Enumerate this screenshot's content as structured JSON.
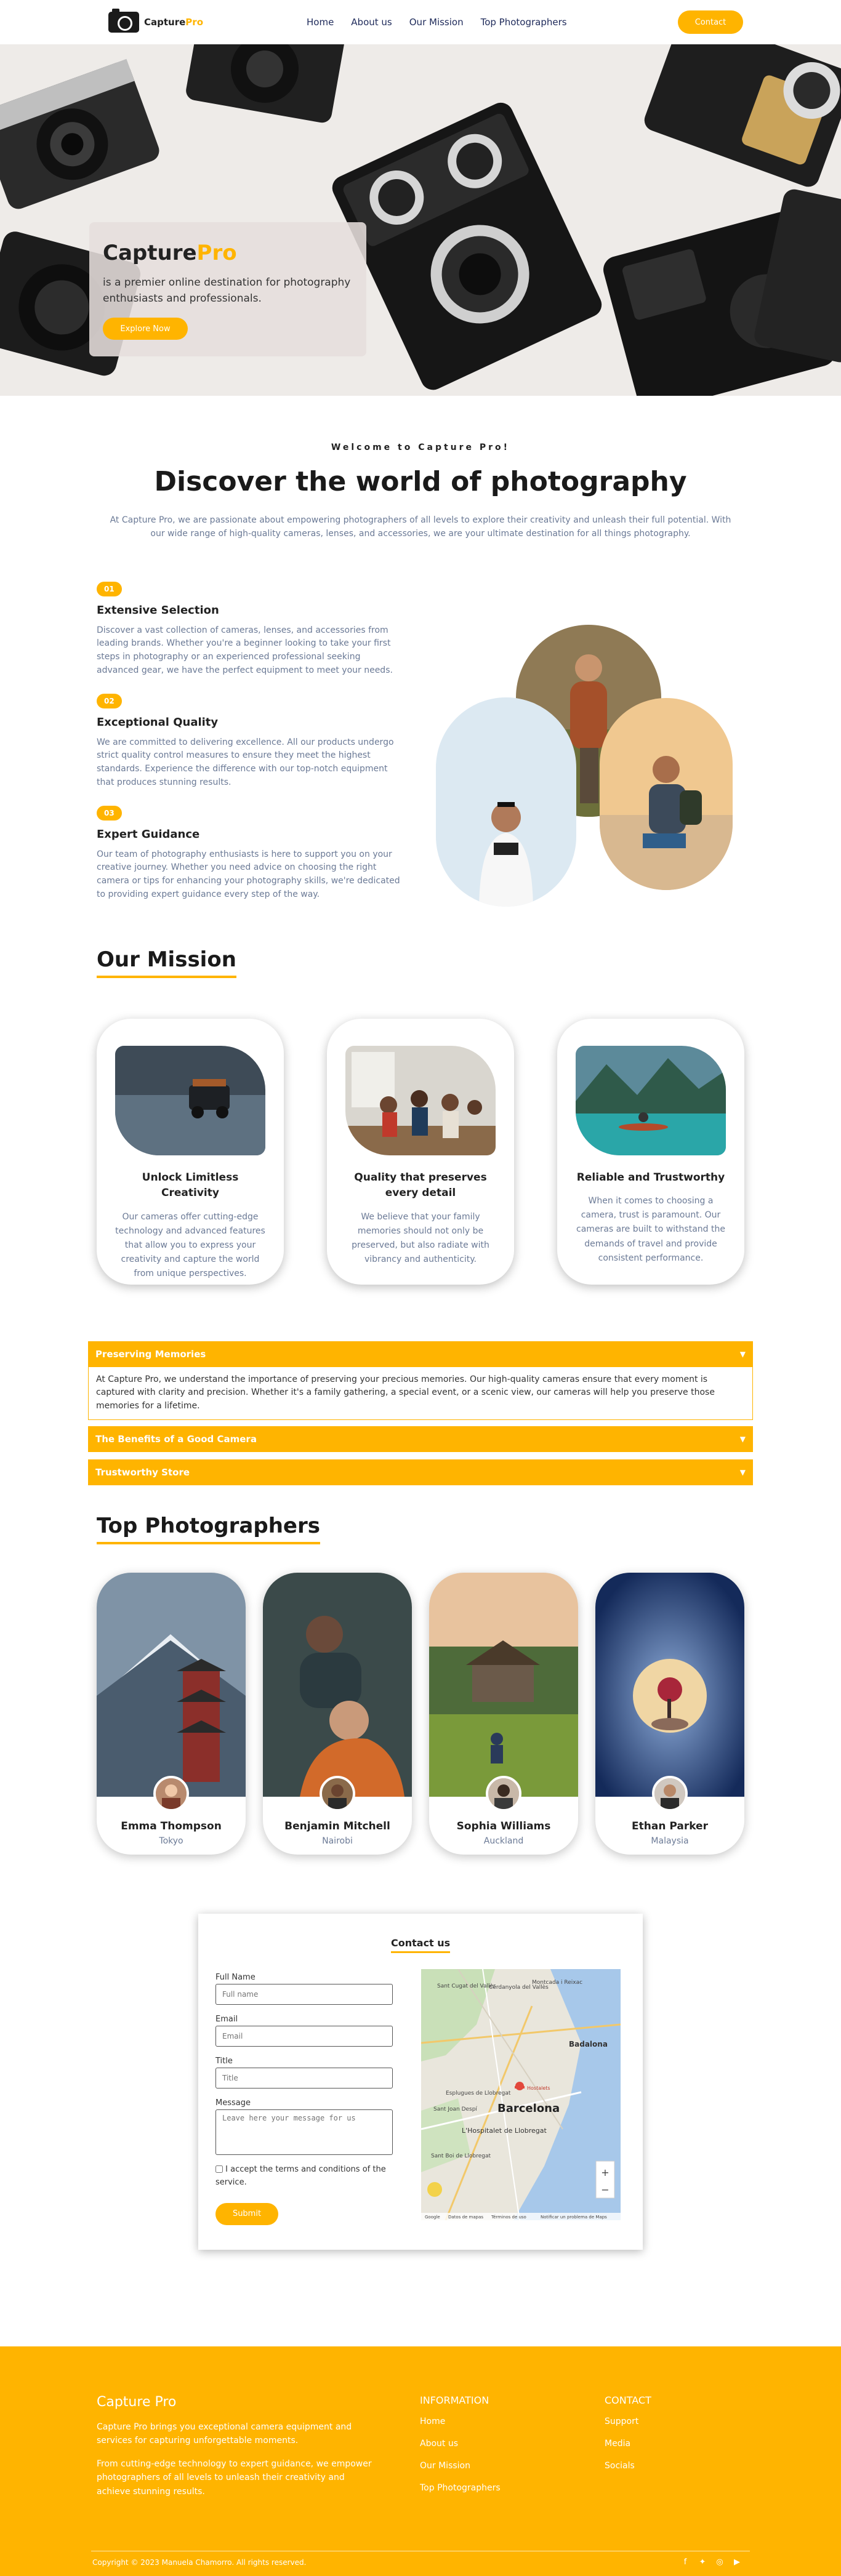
{
  "nav": {
    "brand_main": "Capture",
    "brand_accent": "Pro",
    "links": [
      "Home",
      "About us",
      "Our Mission",
      "Top Photographers"
    ],
    "contact_label": "Contact"
  },
  "hero": {
    "title_main": "Capture",
    "title_accent": "Pro",
    "subtitle": "is a premier online destination for photography enthusiasts and professionals.",
    "button": "Explore Now"
  },
  "welcome": {
    "eyebrow": "Welcome to Capture Pro!",
    "heading": "Discover the world of photography",
    "lead": "At Capture Pro, we are passionate about empowering photographers of all levels to explore their creativity and unleash their full potential. With our wide range of high-quality cameras, lenses, and accessories, we are your ultimate destination for all things photography."
  },
  "features": [
    {
      "badge": "01",
      "title": "Extensive Selection",
      "text": "Discover a vast collection of cameras, lenses, and accessories from leading brands. Whether you're a beginner looking to take your first steps in photography or an experienced professional seeking advanced gear, we have the perfect equipment to meet your needs."
    },
    {
      "badge": "02",
      "title": "Exceptional Quality",
      "text": "We are committed to delivering excellence. All our products undergo strict quality control measures to ensure they meet the highest standards. Experience the difference with our top-notch equipment that produces stunning results."
    },
    {
      "badge": "03",
      "title": "Expert Guidance",
      "text": "Our team of photography enthusiasts is here to support you on your creative journey. Whether you need advice on choosing the right camera or tips for enhancing your photography skills, we're dedicated to providing expert guidance every step of the way."
    }
  ],
  "mission": {
    "heading": "Our Mission",
    "cards": [
      {
        "title": "Unlock Limitless Creativity",
        "text": "Our cameras offer cutting-edge technology and advanced features that allow you to express your creativity and capture the world from unique perspectives."
      },
      {
        "title": "Quality that preserves every detail",
        "text": "We believe that your family memories should not only be preserved, but also radiate with vibrancy and authenticity."
      },
      {
        "title": "Reliable and Trustworthy",
        "text": "When it comes to choosing a camera, trust is paramount. Our cameras are built to withstand the demands of travel and provide consistent performance."
      }
    ]
  },
  "accordion": [
    {
      "title": "Preserving Memories",
      "body": "At Capture Pro, we understand the importance of preserving your precious memories. Our high-quality cameras ensure that every moment is captured with clarity and precision. Whether it's a family gathering, a special event, or a scenic view, our cameras will help you preserve those memories for a lifetime."
    },
    {
      "title": "The Benefits of a Good Camera"
    },
    {
      "title": "Trustworthy Store"
    }
  ],
  "photographers": {
    "heading": "Top Photographers",
    "people": [
      {
        "name": "Emma Thompson",
        "city": "Tokyo"
      },
      {
        "name": "Benjamin Mitchell",
        "city": "Nairobi"
      },
      {
        "name": "Sophia Williams",
        "city": "Auckland"
      },
      {
        "name": "Ethan Parker",
        "city": "Malaysia"
      }
    ]
  },
  "contact": {
    "title": "Contact us",
    "fields": [
      {
        "label": "Full Name",
        "placeholder": "Full name"
      },
      {
        "label": "Email",
        "placeholder": "Email"
      },
      {
        "label": "Title",
        "placeholder": "Title"
      },
      {
        "label": "Message",
        "placeholder": "Leave here your message for us"
      }
    ],
    "checkbox": "I accept the terms and conditions of the service.",
    "submit": "Submit",
    "map_labels": [
      "Sant Cugat del Vallès",
      "Cerdanyola del Vallès",
      "Montcada i Reixac",
      "Badalona",
      "Barcelona",
      "L'Hospitalet de Llobregat",
      "Sant Joan Despí",
      "Sant Boi de Llobregat",
      "Esplugues de Llobregat",
      "Hostalets"
    ],
    "map_footer": [
      "Google",
      "Datos de mapas",
      "Términos de uso",
      "Notificar un problema de Maps"
    ]
  },
  "footer": {
    "brand": "Capture Pro",
    "p1": "Capture Pro brings you exceptional camera equipment and services for capturing unforgettable moments.",
    "p2": "From cutting-edge technology to expert guidance, we empower photographers of all levels to unleash their creativity and achieve stunning results.",
    "info_heading": "INFORMATION",
    "info_links": [
      "Home",
      "About us",
      "Our Mission",
      "Top Photographers"
    ],
    "contact_heading": "CONTACT",
    "contact_links": [
      "Support",
      "Media",
      "Socials"
    ],
    "copyright": "Copyright © 2023 Manuela Chamorro. All rights reserved.",
    "social_icons": [
      "facebook-icon",
      "twitter-icon",
      "instagram-icon",
      "youtube-icon"
    ]
  },
  "colors": {
    "accent": "#ffb400",
    "muted_text": "#6b7a96"
  }
}
